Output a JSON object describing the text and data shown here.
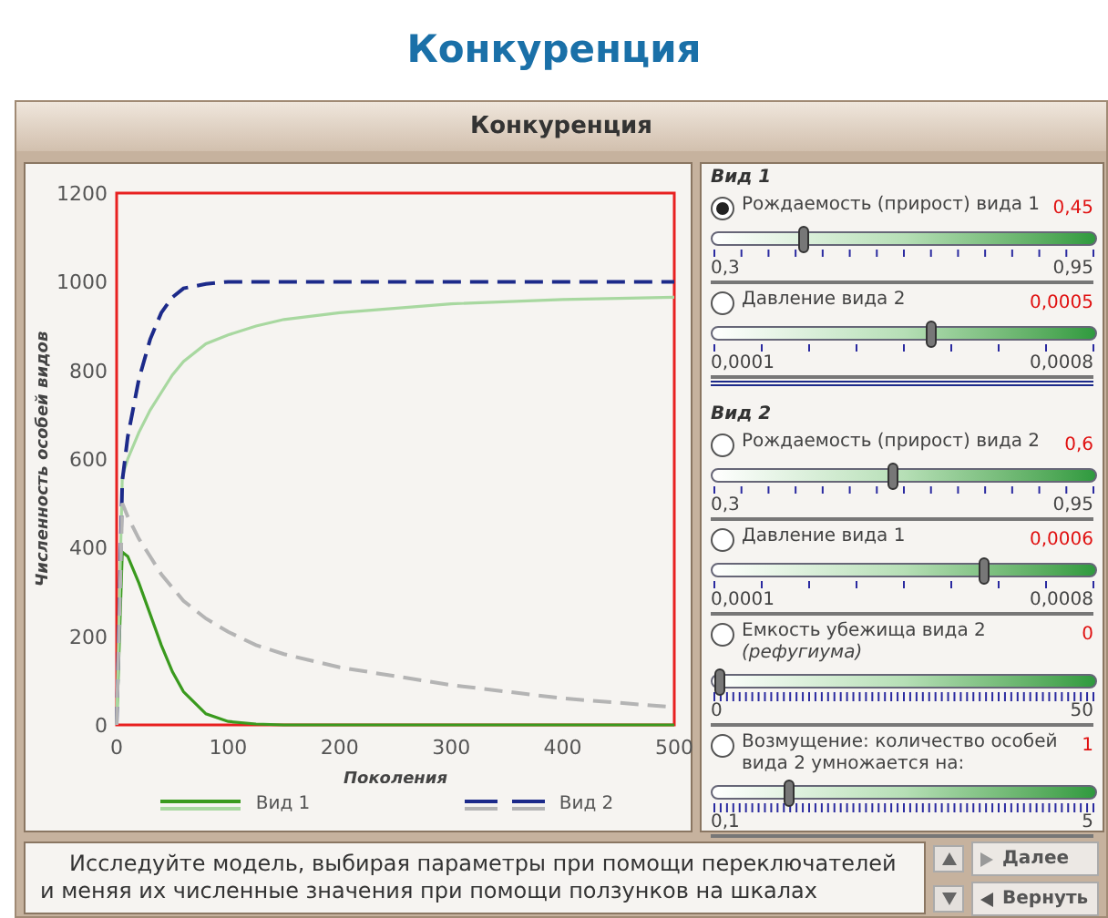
{
  "page_title": "Конкуренция",
  "panel_title": "Конкуренция",
  "chart": {
    "chart_data": {
      "type": "line",
      "xlabel": "Поколения",
      "ylabel": "Численность особей видов",
      "xlim": [
        0,
        500
      ],
      "ylim": [
        0,
        1200
      ],
      "xticks": [
        0,
        100,
        200,
        300,
        400,
        500
      ],
      "yticks": [
        0,
        200,
        400,
        600,
        800,
        1000,
        1200
      ],
      "x": [
        0,
        5,
        10,
        20,
        30,
        40,
        50,
        60,
        80,
        100,
        125,
        150,
        200,
        300,
        400,
        500
      ],
      "series": [
        {
          "name": "Вид 1",
          "color": "#3a9a1e",
          "line_style": "solid",
          "values": [
            0,
            390,
            380,
            320,
            250,
            180,
            120,
            75,
            25,
            8,
            2,
            0,
            0,
            0,
            0,
            0
          ]
        },
        {
          "color": "#a8d8a0",
          "line_style": "solid",
          "values": [
            0,
            560,
            600,
            660,
            710,
            750,
            790,
            820,
            860,
            880,
            900,
            915,
            930,
            950,
            960,
            965
          ]
        },
        {
          "name": "Вид 2",
          "color": "#1c2a8a",
          "line_style": "dashed",
          "values": [
            0,
            550,
            650,
            780,
            870,
            930,
            965,
            985,
            995,
            1000,
            1000,
            1000,
            1000,
            1000,
            1000,
            1000
          ]
        },
        {
          "color": "#b4b4b4",
          "line_style": "dashed",
          "values": [
            0,
            500,
            470,
            420,
            380,
            340,
            310,
            280,
            240,
            210,
            180,
            160,
            130,
            90,
            60,
            40
          ]
        }
      ]
    }
  },
  "groups": [
    {
      "title": "Вид 1",
      "params": [
        {
          "label": "Рождаемость (прирост) вида 1",
          "value": "0,45",
          "selected": true,
          "level": 0.24,
          "min": "0,3",
          "max": "0,95",
          "kind": "sparse"
        },
        {
          "label": "Давление вида 2",
          "value": "0,0005",
          "selected": false,
          "level": 0.57,
          "min": "0,0001",
          "max": "0,0008",
          "kind": "wide"
        }
      ]
    },
    {
      "title": "Вид 2",
      "params": [
        {
          "label": "Рождаемость (прирост) вида 2",
          "value": "0,6",
          "selected": false,
          "level": 0.47,
          "min": "0,3",
          "max": "0,95",
          "kind": "sparse"
        },
        {
          "label": "Давление вида 1",
          "value": "0,0006",
          "selected": false,
          "level": 0.71,
          "min": "0,0001",
          "max": "0,0008",
          "kind": "wide"
        },
        {
          "label": "Емкость убежища вида 2",
          "note": "(рефугиума)",
          "value": "0",
          "selected": false,
          "level": 0.02,
          "min": "0",
          "max": "50",
          "kind": "dense"
        },
        {
          "label": "Возмущение: количество особей вида 2 умножается на:",
          "value": "1",
          "selected": false,
          "level": 0.2,
          "min": "0,1",
          "max": "5",
          "kind": "dense"
        }
      ]
    }
  ],
  "instruction": "Исследуйте модель, выбирая параметры при помощи переключателей и меняя их численные значения при помощи ползунков на шкалах",
  "buttons": [
    {
      "label": "Далее",
      "kind": "next"
    },
    {
      "label": "Вернуть",
      "kind": "back"
    }
  ]
}
